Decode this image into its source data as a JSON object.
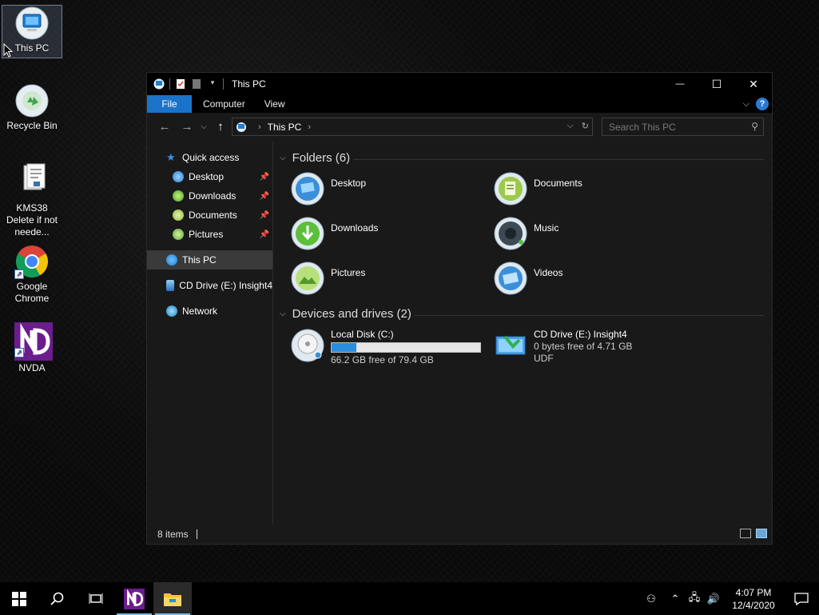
{
  "desktop": {
    "icons": [
      {
        "label": "This PC"
      },
      {
        "label": "Recycle Bin"
      },
      {
        "label": "KMS38 Delete if not neede..."
      },
      {
        "label": "Google Chrome"
      },
      {
        "label": "NVDA"
      }
    ]
  },
  "window": {
    "title": "This PC",
    "controls": {
      "minimize": "—",
      "maximize": "☐",
      "close": "✕"
    },
    "ribbon": {
      "file": "File",
      "tabs": [
        "Computer",
        "View"
      ],
      "help": "?"
    },
    "address": {
      "crumb": "This PC",
      "search_placeholder": "Search This PC"
    },
    "nav": {
      "quick_access": "Quick access",
      "pinned": [
        "Desktop",
        "Downloads",
        "Documents",
        "Pictures"
      ],
      "this_pc": "This PC",
      "cd_drive": "CD Drive (E:) Insight4",
      "network": "Network"
    },
    "folders_header": "Folders (6)",
    "folders": [
      "Desktop",
      "Documents",
      "Downloads",
      "Music",
      "Pictures",
      "Videos"
    ],
    "devices_header": "Devices and drives (2)",
    "drives": [
      {
        "name": "Local Disk (C:)",
        "free": "66.2 GB free of 79.4 GB",
        "used_fraction": 0.166
      },
      {
        "name": "CD Drive (E:) Insight4",
        "free": "0 bytes free of 4.71 GB",
        "fs": "UDF"
      }
    ],
    "status": {
      "items": "8 items"
    }
  },
  "taskbar": {
    "clock_time": "4:07 PM",
    "clock_date": "12/4/2020"
  },
  "colors": {
    "accent": "#1a73c8",
    "bar_fill": "#2a8de0"
  }
}
